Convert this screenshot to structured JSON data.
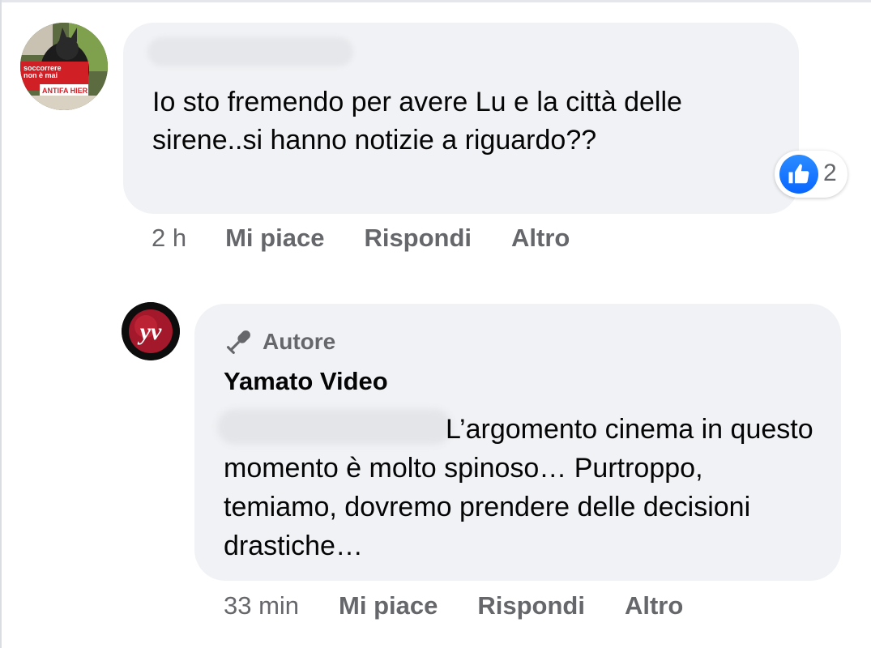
{
  "comments": [
    {
      "avatar": {
        "icon": "user-avatar-photo",
        "sign_text": "soccorrere non è mai ANTIFA HIER"
      },
      "text": "Io sto fremendo per avere Lu e la città delle sirene..si hanno notizie a riguardo??",
      "reactions": {
        "icon": "like-icon",
        "count": "2"
      },
      "actions": {
        "time": "2 h",
        "like": "Mi piace",
        "reply": "Rispondi",
        "more": "Altro"
      }
    },
    {
      "avatar": {
        "icon": "yamato-video-logo",
        "logo_text": "YV"
      },
      "badge": {
        "icon": "microphone-icon",
        "label": "Autore"
      },
      "author": "Yamato Video",
      "text": "L’argomento cinema in questo momento è molto spinoso… Purtroppo, temiamo, dovremo prendere delle decisioni drastiche…",
      "actions": {
        "time": "33 min",
        "like": "Mi piace",
        "reply": "Rispondi",
        "more": "Altro"
      }
    }
  ],
  "colors": {
    "bubble": "#f0f2f5",
    "secondary_text": "#65676b",
    "primary_text": "#050505",
    "like_blue": "#0866ff"
  }
}
